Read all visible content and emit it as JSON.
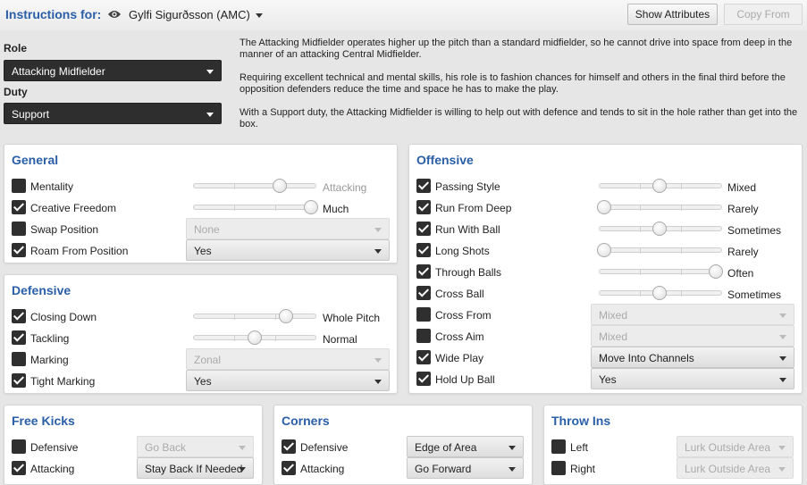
{
  "header": {
    "instructions_label": "Instructions for:",
    "player_name": "Gylfi Sigurðsson (AMC)",
    "show_attributes_label": "Show Attributes",
    "copy_from_label": "Copy From"
  },
  "role": {
    "role_label": "Role",
    "role_value": "Attacking Midfielder",
    "duty_label": "Duty",
    "duty_value": "Support"
  },
  "description": {
    "p1": "The Attacking Midfielder operates higher up the pitch than a standard midfielder, so he cannot drive into space from deep in the manner of an attacking Central Midfielder.",
    "p2": "Requiring excellent technical and mental skills, his role is to fashion chances for himself and others in the final third before the opposition defenders reduce the time and space he has to make the play.",
    "p3": "With a Support duty, the Attacking Midfielder is willing to help out with defence and tends to sit in the hole rather than get into the box."
  },
  "general": {
    "title": "General",
    "mentality": {
      "label": "Mentality",
      "value": "Attacking",
      "checked": false,
      "level": 0.7
    },
    "creative_freedom": {
      "label": "Creative Freedom",
      "value": "Much",
      "checked": true,
      "level": 1.0
    },
    "swap_position": {
      "label": "Swap Position",
      "value": "None",
      "checked": false
    },
    "roam_from_position": {
      "label": "Roam From Position",
      "value": "Yes",
      "checked": true
    }
  },
  "defensive": {
    "title": "Defensive",
    "closing_down": {
      "label": "Closing Down",
      "value": "Whole Pitch",
      "checked": true,
      "level": 0.75
    },
    "tackling": {
      "label": "Tackling",
      "value": "Normal",
      "checked": true,
      "level": 0.5
    },
    "marking": {
      "label": "Marking",
      "value": "Zonal",
      "checked": false
    },
    "tight_marking": {
      "label": "Tight Marking",
      "value": "Yes",
      "checked": true
    }
  },
  "offensive": {
    "title": "Offensive",
    "passing_style": {
      "label": "Passing Style",
      "value": "Mixed",
      "checked": true,
      "level": 0.5
    },
    "run_from_deep": {
      "label": "Run From Deep",
      "value": "Rarely",
      "checked": true,
      "level": 0.0
    },
    "run_with_ball": {
      "label": "Run With Ball",
      "value": "Sometimes",
      "checked": true,
      "level": 0.5
    },
    "long_shots": {
      "label": "Long Shots",
      "value": "Rarely",
      "checked": true,
      "level": 0.0
    },
    "through_balls": {
      "label": "Through Balls",
      "value": "Often",
      "checked": true,
      "level": 1.0
    },
    "cross_ball": {
      "label": "Cross Ball",
      "value": "Sometimes",
      "checked": true,
      "level": 0.5
    },
    "cross_from": {
      "label": "Cross From",
      "value": "Mixed",
      "checked": false
    },
    "cross_aim": {
      "label": "Cross Aim",
      "value": "Mixed",
      "checked": false
    },
    "wide_play": {
      "label": "Wide Play",
      "value": "Move Into Channels",
      "checked": true
    },
    "hold_up_ball": {
      "label": "Hold Up Ball",
      "value": "Yes",
      "checked": true
    }
  },
  "free_kicks": {
    "title": "Free Kicks",
    "defensive": {
      "label": "Defensive",
      "value": "Go Back",
      "checked": false
    },
    "attacking": {
      "label": "Attacking",
      "value": "Stay Back If Needed",
      "checked": true
    }
  },
  "corners": {
    "title": "Corners",
    "defensive": {
      "label": "Defensive",
      "value": "Edge of Area",
      "checked": true
    },
    "attacking": {
      "label": "Attacking",
      "value": "Go Forward",
      "checked": true
    }
  },
  "throw_ins": {
    "title": "Throw Ins",
    "left": {
      "label": "Left",
      "value": "Lurk Outside Area",
      "checked": false
    },
    "right": {
      "label": "Right",
      "value": "Lurk Outside Area",
      "checked": false
    }
  },
  "colors": {
    "accent": "#2a5fa8",
    "dark": "#2e2e2e"
  },
  "icons": {
    "eye": "eye-icon",
    "dropdown": "chevron-down-icon",
    "checkbox": "checkbox-icon"
  }
}
